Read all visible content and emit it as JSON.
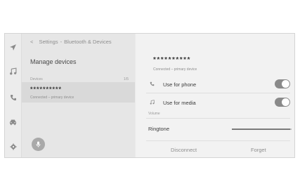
{
  "breadcrumb": {
    "back": "<",
    "root": "Settings",
    "sep": "-",
    "current": "Bluetooth & Devices"
  },
  "left": {
    "title": "Manage devices",
    "devices_label": "Devices",
    "devices_count": "1/5",
    "device": {
      "name": "**********",
      "status": "Connected – primary device"
    }
  },
  "right": {
    "device_name": "**********",
    "device_status": "Connected – primary device",
    "options": [
      {
        "label": "Use for phone",
        "icon": "phone-icon",
        "on": true
      },
      {
        "label": "Use for media",
        "icon": "music-note-icon",
        "on": true
      }
    ],
    "volume_label": "Volume",
    "ringtone_label": "Ringtone",
    "ringtone_level": 0.98,
    "disconnect_label": "Disconnect",
    "forget_label": "Forget"
  },
  "rail": [
    "navigation-icon",
    "music-icon",
    "phone-icon",
    "car-icon",
    "settings-icon"
  ],
  "colors": {
    "toggle_on": "#8a8a8a",
    "selected_row": "#d9d9d9"
  }
}
